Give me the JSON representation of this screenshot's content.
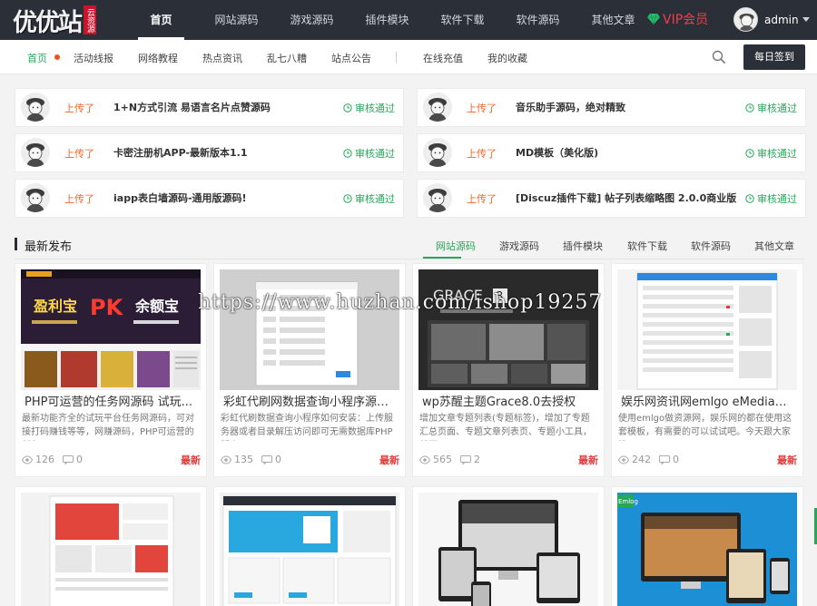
{
  "logo": {
    "text": "优优站",
    "badge": "云资源"
  },
  "main_nav": [
    {
      "label": "首页",
      "active": true
    },
    {
      "label": "网站源码"
    },
    {
      "label": "游戏源码"
    },
    {
      "label": "插件模块"
    },
    {
      "label": "软件下载"
    },
    {
      "label": "软件源码"
    },
    {
      "label": "其他文章"
    }
  ],
  "vip": {
    "label": "VIP会员"
  },
  "user": {
    "name": "admin"
  },
  "sub_nav": [
    {
      "label": "首页",
      "active": true
    },
    {
      "label": "活动线报"
    },
    {
      "label": "网络教程"
    },
    {
      "label": "热点资讯"
    },
    {
      "label": "乱七八糟"
    },
    {
      "label": "站点公告"
    },
    {
      "label": "在线充值"
    },
    {
      "label": "我的收藏"
    }
  ],
  "checkin_label": "每日签到",
  "uploads": [
    {
      "action": "上传了",
      "title": "1+N方式引流 易语言名片点赞源码",
      "status": "审核通过"
    },
    {
      "action": "上传了",
      "title": "音乐助手源码，绝对精致",
      "status": "审核通过"
    },
    {
      "action": "上传了",
      "title": "卡密注册机APP-最新版本1.1",
      "status": "审核通过"
    },
    {
      "action": "上传了",
      "title": "MD模板（美化版)",
      "status": "审核通过"
    },
    {
      "action": "上传了",
      "title": "iapp表白墙源码-通用版源码!",
      "status": "审核通过"
    },
    {
      "action": "上传了",
      "title": "[Discuz插件下载] 帖子列表缩略图 2.0.0商业版",
      "status": "审核通过"
    }
  ],
  "section": {
    "title": "最新发布",
    "tabs": [
      {
        "label": "网站源码",
        "active": true
      },
      {
        "label": "游戏源码"
      },
      {
        "label": "插件模块"
      },
      {
        "label": "软件下载"
      },
      {
        "label": "软件源码"
      },
      {
        "label": "其他文章"
      }
    ]
  },
  "posts": [
    {
      "title": "PHP可运营的任务网源码 试玩...",
      "desc": "最新功能齐全的试玩平台任务网源码，可对接打码赚钱等等，网赚源码，PHP可运营的任务",
      "views": "126",
      "comments": "0",
      "badge": "最新"
    },
    {
      "title": "彩虹代刷网数据查询小程序源码...",
      "desc": "彩虹代刷数据查询小程序如何安装：上传服务器或者目录解压访问即可无需数据库PHP版本",
      "views": "135",
      "comments": "0",
      "badge": "最新"
    },
    {
      "title": "wp苏醒主题Grace8.0去授权",
      "desc": "增加文章专题列表(专题标签)，增加了专题汇总页面、专题文章列表页、专题小工具，首页",
      "views": "565",
      "comments": "2",
      "badge": "最新"
    },
    {
      "title": "娱乐网资讯网emlgo eMedia媒...",
      "desc": "使用emlgo做资源网，娱乐网的都在使用这套模板，有需要的可以试试吧。今天跟大家推",
      "views": "242",
      "comments": "0",
      "badge": "最新"
    }
  ],
  "thumb_text": {
    "p1_brand": "盈利宝",
    "p1_pk": "PK",
    "p1_rival": "余额宝",
    "p3_brand": "GRACE",
    "p3_ver": "8",
    "p8_brand": "Emlog"
  },
  "watermark": "https://www.huzhan.com/ishop19257",
  "colors": {
    "accent": "#26a85a",
    "dark_nav": "#2a2f38",
    "upload_action": "#f0652a",
    "new_badge": "#e03a3a",
    "vip": "#f23d4c"
  }
}
